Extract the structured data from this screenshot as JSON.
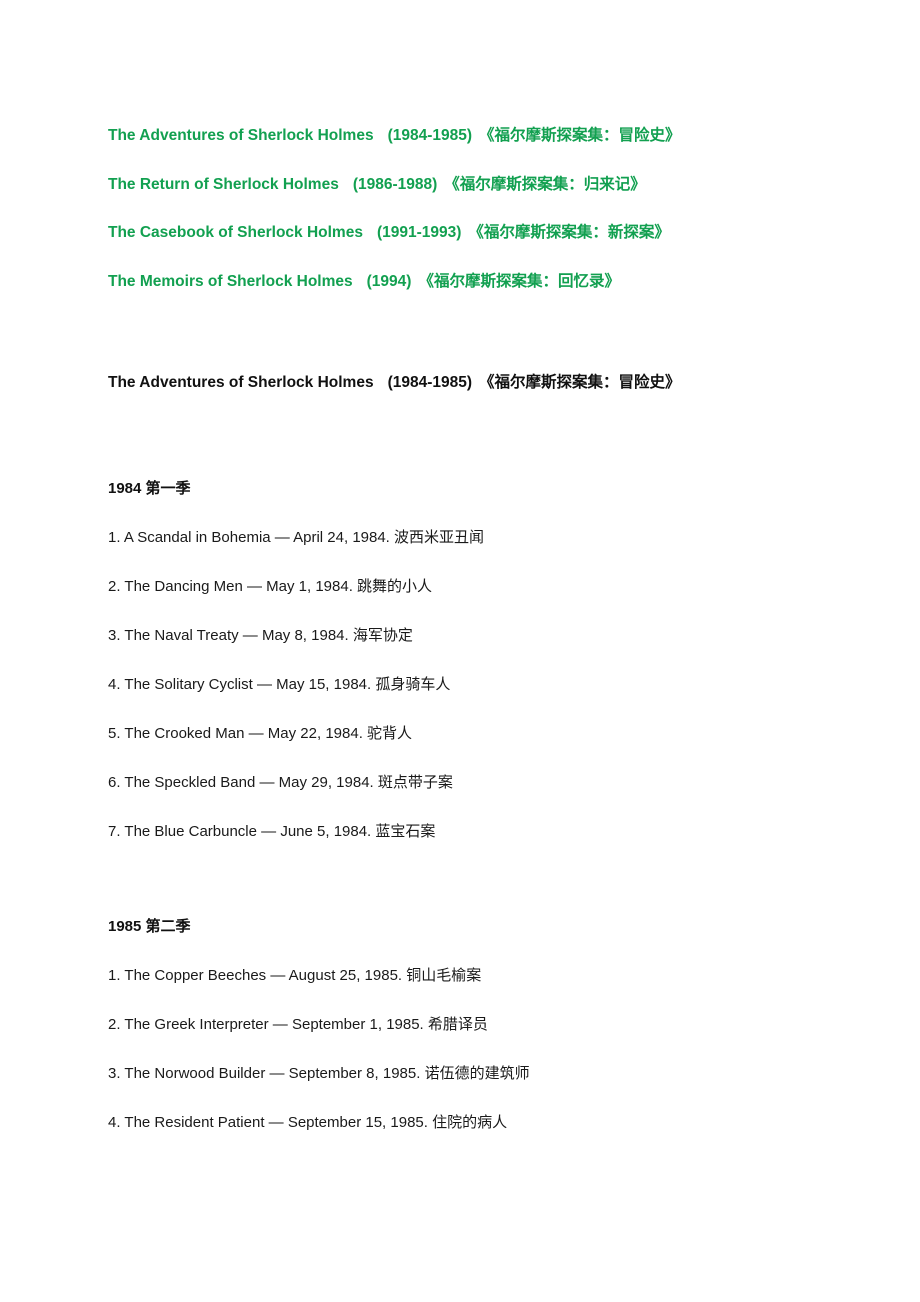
{
  "document": {
    "toc": {
      "items": [
        {
          "title": "The Adventures of Sherlock Holmes",
          "years": "(1984-1985)",
          "chinese": "《福尔摩斯探案集：冒险史》"
        },
        {
          "title": "The Return of Sherlock Holmes",
          "years": "(1986-1988)",
          "chinese": "《福尔摩斯探案集：归来记》"
        },
        {
          "title": "The Casebook of Sherlock Holmes",
          "years": "(1991-1993)",
          "chinese": "《福尔摩斯探案集：新探案》"
        },
        {
          "title": "The Memoirs of Sherlock Holmes",
          "years": "(1994)",
          "chinese": "《福尔摩斯探案集：回忆录》"
        }
      ]
    },
    "section": {
      "title": "The Adventures of Sherlock Holmes",
      "years": "(1984-1985)",
      "chinese": "《福尔摩斯探案集：冒险史》"
    },
    "seasons": [
      {
        "heading": "1984  第一季",
        "episodes": [
          "1. A Scandal in Bohemia — April 24, 1984.  波西米亚丑闻",
          "2. The Dancing Men — May 1, 1984.  跳舞的小人",
          "3. The Naval Treaty — May 8, 1984.  海军协定",
          "4. The Solitary Cyclist — May 15, 1984.  孤身骑车人",
          "5. The Crooked Man — May 22, 1984.  驼背人",
          "6. The Speckled Band — May 29, 1984.  斑点带子案",
          "7. The Blue Carbuncle — June 5, 1984.  蓝宝石案"
        ]
      },
      {
        "heading": "1985  第二季",
        "episodes": [
          "1. The Copper Beeches — August 25, 1985.  铜山毛榆案",
          "2. The Greek Interpreter — September 1, 1985.  希腊译员",
          "3. The Norwood Builder — September 8, 1985.  诺伍德的建筑师",
          "4. The Resident Patient — September 15, 1985.  住院的病人"
        ]
      }
    ],
    "colors": {
      "link_green": "#12a050",
      "text_black": "#1a1a1a"
    }
  }
}
